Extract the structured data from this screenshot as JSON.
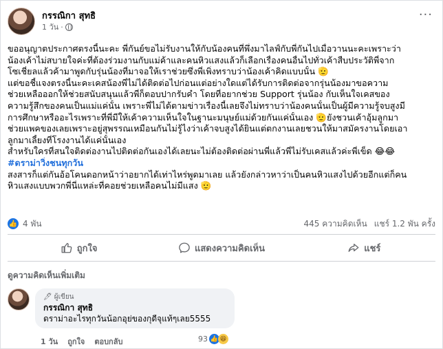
{
  "post": {
    "author": "กรรณิกา สุทธิ",
    "time": "1 วัน",
    "privacy_icon": "globe-icon",
    "lines": [
      "ขออนุญาตประกาศตรงนี้นะคะ พี่กันย์ขอไม่รับงานให้กับน้องคนที่พึ่งมาไลฟ์กับพี่กันไปเมื่อวานนะคะเพราะว่า",
      "น้องเค้าไม่สบายใจค่ะที่ต้องร่วมงานกับแม่ค้าและคนหิวแสงแล้วก็เลือกเรื่องคนอื่นไปทั่วเค้าสืบประวัติพี่จาก",
      "โซเชี่ยลแล้วค้ามาพูดกับรุ่นน้องที่มาจอให้เราช่วยซึ่งพี่เพิ่งทราบว่าน้องเค้าคิดแบบนั้น 🫡",
      "แต่ขอชี้แจงตรงนี้นะคะเคสน้องพี่ไม่ได้ติดต่อไปก่อนแต่อย่างใดแต่ได้รับการติดต่อจากรุ่นน้องมาขอความ",
      "ช่วยเหลือออกให้ช่วยสนับสนุนแล้วพี่ก็ตอบปากรับคำ โดยที่อยากช่วย Support รุ่นน้อง กับเห็นใจเคสของ",
      "ความรู้สึกของคนเป็นแม่แค่นั้น เพราะพี่ไม่ได้ตามข่าวเรื่องนี้เลยจึงไม่ทราบว่าน้องคนนั้นเป็นผู้มีความรู้จบสูงมี",
      "การศึกษาหรืออะไรเพราะที่พี่มีให้เค้าความเห็นใจในฐานะมนุษย์แม่ด้วยกันแค่นั้นเอง 🫡ยังชวนเค้าอุ้มลูกมา",
      "ช่วยแพคของเลยเพราะอยู่สุพรรณเหมือนกันไม่รู้ไงว่าเค้าจบสูงได้ยินแต่ตกงานเลยชวนให้มาสมัครงานโดยเอา",
      "ลูกมาเลี้ยงที่โรงงานได้แค่นั้นเอง",
      "สำหรับใครที่สนใจติดต่องานไปติดต่อกันเองได้เลยนะไม่ต้องติดต่อผ่านพี่แล้วพี่ไม่รับเคสแล้วค่ะพี่เข็ด 😂😂"
    ],
    "hashtag": "#ดราม่าวิ่งชนทุกวัน",
    "lines2": [
      "สงสารก็แต่กันอ้อโคนดอกหน้าว่าอยากได้เท่าไหร่พูดมาเลย แล้วยังกล่าวหาว่าเป็นคนหิวแสงไปด้วยอีกแต่ก็คน",
      "หิวแสงแบบพวกพี่นี่แหล่ะที่คอยช่วยเหลือคนไม่มีแสง 🫡"
    ]
  },
  "stats": {
    "likes": "4 พัน",
    "comments": "445 ความคิดเห็น",
    "shares": "แชร์ 1.2 พัน ครั้ง"
  },
  "actions": {
    "like": "ถูกใจ",
    "comment": "แสดงความคิดเห็น",
    "share": "แชร์"
  },
  "more_comments": "ดูความคิดเห็นเพิ่มเติม",
  "comment": {
    "role": "ผู้เขียน",
    "author": "กรรณิกา สุทธิ",
    "text": "ดราม่าอะไรทุกวันน้อกอุย่ของกุดีจุแท้ๆเลย5555",
    "time": "1 วัน",
    "like": "ถูกใจ",
    "reply": "ตอบกลับ",
    "reactions": "93"
  },
  "colors": {
    "accent": "#1b74e4",
    "hashtag": "#216fdb",
    "muted": "#65676b"
  }
}
